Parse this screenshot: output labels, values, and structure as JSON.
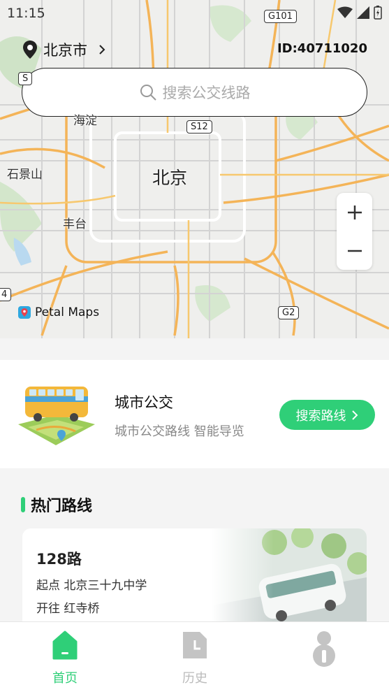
{
  "status_bar": {
    "time": "11:15"
  },
  "header": {
    "city": "北京市",
    "user_id": "ID:40711020"
  },
  "search": {
    "placeholder": "搜索公交线路"
  },
  "map": {
    "labels": {
      "center": "北京",
      "shijingshan": "石景山",
      "fengtai": "丰台",
      "haidian": "海淀"
    },
    "roads": {
      "g101": "G101",
      "s12": "S12",
      "g2": "G2",
      "s": "S",
      "four": "4"
    },
    "attribution": "Petal Maps",
    "zoom_in": "+",
    "zoom_out": "−"
  },
  "promo": {
    "title": "城市公交",
    "subtitle": "城市公交路线 智能导览",
    "button_label": "搜索路线"
  },
  "hot_routes": {
    "title": "热门路线",
    "items": [
      {
        "name": "128路",
        "from": "起点 北京三十九中学",
        "to": "开往 红寺桥"
      }
    ]
  },
  "nav": {
    "home": "首页",
    "history": "历史",
    "active": "home"
  },
  "colors": {
    "accent": "#2fcf78",
    "inactive": "#bbbbbb"
  }
}
